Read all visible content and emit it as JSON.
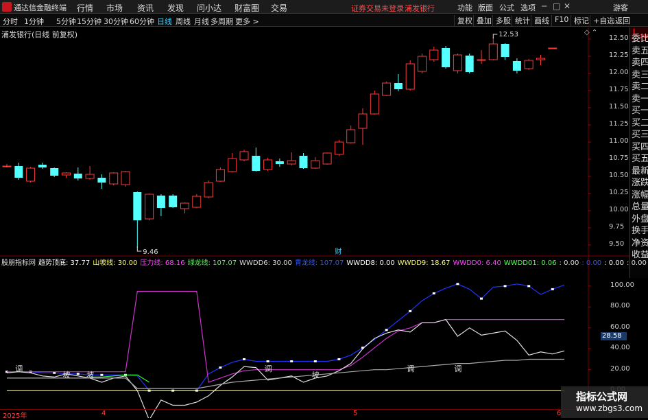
{
  "titlebar": {
    "app_name": "通达信金融终端",
    "menu": [
      "行情",
      "市场",
      "资讯",
      "发现",
      "问小达",
      "财富圈",
      "交易"
    ],
    "notice": "证券交易未登录",
    "stock_name": "浦发银行",
    "right_menu": [
      "功能",
      "版面",
      "公式",
      "选项"
    ],
    "user": "游客"
  },
  "toolbar": {
    "timeframes": [
      "分时",
      "1分钟",
      "5分钟",
      "15分钟",
      "30分钟",
      "60分钟",
      "日线",
      "周线",
      "月线",
      "多周期",
      "更多 >"
    ],
    "active_timeframe": "日线",
    "buttons": [
      "复权",
      "叠加",
      "多股",
      "统计",
      "画线",
      "F10",
      "标记",
      "+自选",
      "返回"
    ]
  },
  "main_chart": {
    "header": "浦发银行(日线 前复权)",
    "high_label": "12.53",
    "low_label": "9.46",
    "marker": "财",
    "controls": "◇ ⌃"
  },
  "side_panel": {
    "badge_top": "L",
    "badge_bottom": "300",
    "items": [
      "委比",
      "卖五",
      "卖四",
      "卖三",
      "卖二",
      "卖一",
      "买一",
      "买二",
      "买三",
      "买四",
      "买五",
      "最新",
      "涨跌",
      "涨幅",
      "总量",
      "外盘",
      "换手",
      "净资",
      "收益"
    ]
  },
  "sub_chart": {
    "header_items": [
      {
        "text": "股朋指标网",
        "color": "#dddddd"
      },
      {
        "text": "趋势顶底: 37.77",
        "color": "#ffffff"
      },
      {
        "text": "山坡线: 30.00",
        "color": "#ffff55"
      },
      {
        "text": "压力线: 68.16",
        "color": "#ff44ff"
      },
      {
        "text": "绿龙线: 107.07",
        "color": "#55ff55"
      },
      {
        "text": "WWDD6: 30.00",
        "color": "#dddddd"
      },
      {
        "text": "青龙线: 107.07",
        "color": "#3355ff"
      },
      {
        "text": "WWDD8: 0.00",
        "color": "#ffffff"
      },
      {
        "text": "WWDD9: 18.67",
        "color": "#ffff55"
      },
      {
        "text": "WWDD0: 6.40",
        "color": "#ff44ff"
      },
      {
        "text": "WWDD01: 0.06",
        "color": "#55ff55"
      },
      {
        "text": ": 0.00",
        "color": "#dddddd"
      },
      {
        "text": ": 0.00",
        "color": "#3355ff"
      },
      {
        "text": ": 0.00",
        "color": "#ffffff"
      },
      {
        "text": ": 0.00",
        "color": "#dddddd"
      }
    ],
    "current_value": "28.58",
    "labels": [
      {
        "text": "调",
        "day": 1
      },
      {
        "text": "坡",
        "day": 5
      },
      {
        "text": "坡",
        "day": 7
      },
      {
        "text": "调",
        "day": 22
      },
      {
        "text": "坡",
        "day": 26
      },
      {
        "text": "调",
        "day": 34
      },
      {
        "text": "调",
        "day": 38
      }
    ]
  },
  "date_axis": [
    "2025年",
    "4",
    "5",
    "6"
  ],
  "watermark": {
    "line1": "指标公式网",
    "line2": "www.zbgs3.com"
  },
  "colors": {
    "up": "#ff3a3a",
    "down": "#54ffff",
    "blue_line": "#2233ff",
    "magenta_line": "#cc33cc",
    "white_line": "#e0e0e0",
    "yellow_line": "#ffff66",
    "green_line": "#33ff33"
  },
  "chart_data": {
    "type": "candlestick",
    "price_ylim": [
      9.35,
      12.62
    ],
    "price_ticks": [
      12.5,
      12.25,
      12.0,
      11.75,
      11.5,
      11.25,
      11.0,
      10.75,
      10.5,
      10.25,
      10.0,
      9.75,
      9.5
    ],
    "candles": [
      {
        "o": 10.65,
        "h": 10.68,
        "l": 10.63,
        "c": 10.65
      },
      {
        "o": 10.65,
        "h": 10.7,
        "l": 10.45,
        "c": 10.48
      },
      {
        "o": 10.43,
        "h": 10.64,
        "l": 10.41,
        "c": 10.62
      },
      {
        "o": 10.67,
        "h": 10.7,
        "l": 10.61,
        "c": 10.63
      },
      {
        "o": 10.62,
        "h": 10.63,
        "l": 10.49,
        "c": 10.51
      },
      {
        "o": 10.52,
        "h": 10.56,
        "l": 10.48,
        "c": 10.55
      },
      {
        "o": 10.54,
        "h": 10.63,
        "l": 10.44,
        "c": 10.47
      },
      {
        "o": 10.47,
        "h": 10.65,
        "l": 10.45,
        "c": 10.53
      },
      {
        "o": 10.48,
        "h": 10.53,
        "l": 10.32,
        "c": 10.41
      },
      {
        "o": 10.39,
        "h": 10.56,
        "l": 10.37,
        "c": 10.55
      },
      {
        "o": 10.38,
        "h": 10.58,
        "l": 10.35,
        "c": 10.57
      },
      {
        "o": 10.27,
        "h": 10.28,
        "l": 9.46,
        "c": 9.86
      },
      {
        "o": 9.88,
        "h": 10.25,
        "l": 9.86,
        "c": 10.24
      },
      {
        "o": 10.22,
        "h": 10.24,
        "l": 9.92,
        "c": 10.04
      },
      {
        "o": 10.22,
        "h": 10.24,
        "l": 10.04,
        "c": 10.05
      },
      {
        "o": 10.03,
        "h": 10.12,
        "l": 9.96,
        "c": 10.11
      },
      {
        "o": 10.05,
        "h": 10.24,
        "l": 10.04,
        "c": 10.21
      },
      {
        "o": 10.2,
        "h": 10.44,
        "l": 10.18,
        "c": 10.41
      },
      {
        "o": 10.43,
        "h": 10.63,
        "l": 10.42,
        "c": 10.6
      },
      {
        "o": 10.57,
        "h": 10.84,
        "l": 10.56,
        "c": 10.76
      },
      {
        "o": 10.74,
        "h": 10.89,
        "l": 10.72,
        "c": 10.86
      },
      {
        "o": 10.8,
        "h": 10.92,
        "l": 10.57,
        "c": 10.58
      },
      {
        "o": 10.6,
        "h": 10.77,
        "l": 10.58,
        "c": 10.74
      },
      {
        "o": 10.72,
        "h": 10.76,
        "l": 10.64,
        "c": 10.68
      },
      {
        "o": 10.68,
        "h": 10.85,
        "l": 10.66,
        "c": 10.73
      },
      {
        "o": 10.8,
        "h": 10.84,
        "l": 10.61,
        "c": 10.62
      },
      {
        "o": 10.62,
        "h": 10.78,
        "l": 10.61,
        "c": 10.73
      },
      {
        "o": 10.68,
        "h": 10.85,
        "l": 10.67,
        "c": 10.84
      },
      {
        "o": 10.82,
        "h": 11.03,
        "l": 10.8,
        "c": 11.0
      },
      {
        "o": 10.99,
        "h": 11.24,
        "l": 10.98,
        "c": 11.18
      },
      {
        "o": 11.2,
        "h": 11.49,
        "l": 10.96,
        "c": 11.41
      },
      {
        "o": 11.41,
        "h": 11.75,
        "l": 11.4,
        "c": 11.7
      },
      {
        "o": 11.68,
        "h": 11.88,
        "l": 11.67,
        "c": 11.86
      },
      {
        "o": 11.86,
        "h": 11.99,
        "l": 11.74,
        "c": 11.77
      },
      {
        "o": 11.77,
        "h": 12.19,
        "l": 11.75,
        "c": 12.14
      },
      {
        "o": 12.03,
        "h": 12.29,
        "l": 12.0,
        "c": 12.25
      },
      {
        "o": 12.2,
        "h": 12.39,
        "l": 12.17,
        "c": 12.34
      },
      {
        "o": 12.37,
        "h": 12.4,
        "l": 12.07,
        "c": 12.09
      },
      {
        "o": 12.04,
        "h": 12.29,
        "l": 12.0,
        "c": 12.27
      },
      {
        "o": 12.26,
        "h": 12.29,
        "l": 12.0,
        "c": 12.02
      },
      {
        "o": 12.2,
        "h": 12.34,
        "l": 12.14,
        "c": 12.2
      },
      {
        "o": 12.2,
        "h": 12.53,
        "l": 12.19,
        "c": 12.43
      },
      {
        "o": 12.43,
        "h": 12.44,
        "l": 12.2,
        "c": 12.24
      },
      {
        "o": 12.18,
        "h": 12.22,
        "l": 12.0,
        "c": 12.04
      },
      {
        "o": 12.07,
        "h": 12.21,
        "l": 12.05,
        "c": 12.19
      },
      {
        "o": 12.2,
        "h": 12.27,
        "l": 12.12,
        "c": 12.22
      },
      {
        "o": 12.37,
        "h": 12.37,
        "l": 12.37,
        "c": 12.37
      }
    ],
    "sub_ylim": [
      -15,
      115
    ],
    "sub_ticks": [
      100.0,
      80.0,
      60.0,
      40.0,
      20.0,
      0.0
    ],
    "series": [
      {
        "name": "青龙线",
        "color": "#2233ff",
        "dots": true,
        "values": [
          18,
          18,
          18,
          17,
          17,
          16,
          16,
          15,
          15,
          15,
          15,
          14,
          0,
          0,
          0,
          0,
          0,
          16,
          22,
          27,
          30,
          28,
          28,
          28,
          28,
          28,
          28,
          28,
          30,
          34,
          41,
          49,
          58,
          67,
          76,
          86,
          93,
          98,
          102,
          97,
          88,
          99,
          100,
          102,
          100,
          92,
          97,
          101
        ]
      },
      {
        "name": "压力线",
        "color": "#cc33cc",
        "values": [
          18,
          18,
          18,
          18,
          18,
          18,
          18,
          18,
          18,
          18,
          18,
          95,
          95,
          95,
          95,
          95,
          95,
          8,
          12,
          16,
          19,
          20,
          20,
          20,
          20,
          20,
          20,
          20,
          20,
          24,
          32,
          41,
          50,
          57,
          60,
          65,
          65,
          68,
          68,
          68,
          68,
          68,
          68,
          68,
          68,
          68,
          68,
          68
        ]
      },
      {
        "name": "趋势顶底",
        "color": "#e0e0e0",
        "values": [
          17,
          18,
          17,
          14,
          13,
          16,
          14,
          12,
          8,
          12,
          14,
          0,
          -28,
          -9,
          -14,
          -14,
          -11,
          -5,
          5,
          13,
          23,
          22,
          10,
          12,
          14,
          8,
          12,
          14,
          19,
          26,
          40,
          50,
          55,
          58,
          56,
          65,
          65,
          68,
          52,
          60,
          53,
          55,
          57,
          48,
          34,
          37,
          35,
          38
        ]
      },
      {
        "name": "山坡线",
        "color": "#ffff66",
        "values": [
          0,
          0,
          0,
          0,
          0,
          0,
          0,
          0,
          0,
          0,
          0,
          0,
          0,
          0,
          0,
          0,
          0,
          0,
          0,
          0,
          0,
          0,
          0,
          0,
          0,
          0,
          0,
          0,
          0,
          0,
          0,
          0,
          0,
          0,
          0,
          0,
          0,
          0,
          0,
          0,
          0,
          0,
          0,
          0,
          0,
          0,
          0,
          0
        ]
      },
      {
        "name": "WWDD6",
        "color": "#aaaaaa",
        "values": [
          12,
          12,
          12,
          12,
          12,
          12,
          12,
          12,
          12,
          12,
          12,
          2,
          2,
          2,
          2,
          2,
          2,
          4,
          6,
          8,
          9,
          10,
          11,
          12,
          13,
          14,
          15,
          16,
          17,
          18,
          19,
          20,
          20,
          21,
          22,
          23,
          24,
          25,
          26,
          26,
          27,
          28,
          29,
          29,
          30,
          30,
          30,
          30
        ]
      },
      {
        "name": "绿龙线",
        "color": "#33ff33",
        "values": [
          null,
          null,
          null,
          null,
          null,
          null,
          null,
          13,
          13,
          14,
          15,
          15,
          8,
          null,
          null,
          null,
          null,
          null,
          null,
          null,
          null,
          null,
          null,
          null,
          null,
          null,
          null,
          null,
          null,
          null,
          null,
          null,
          null,
          null,
          null,
          null,
          null,
          null,
          null,
          null,
          null,
          null,
          null,
          null,
          null,
          null,
          null,
          null
        ]
      }
    ]
  }
}
